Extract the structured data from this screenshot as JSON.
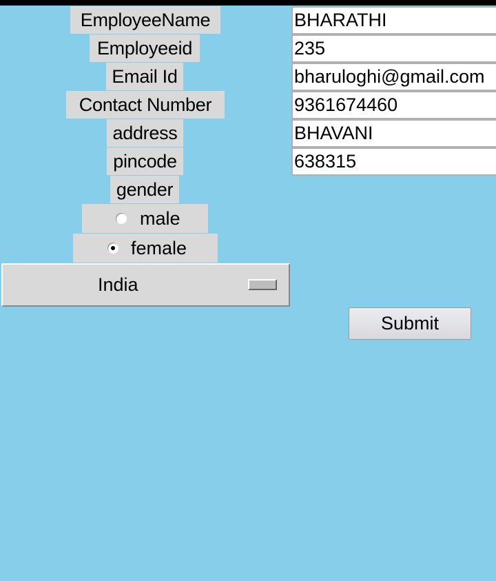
{
  "form": {
    "fields": [
      {
        "label": "EmployeeName",
        "value": "BHARATHI"
      },
      {
        "label": "Employeeid",
        "value": "235"
      },
      {
        "label": "Email Id",
        "value": "bharuloghi@gmail.com"
      },
      {
        "label": "Contact Number",
        "value": "9361674460"
      },
      {
        "label": "address",
        "value": "BHAVANI"
      },
      {
        "label": "pincode",
        "value": "638315"
      }
    ],
    "gender_label": "gender",
    "gender_options": [
      {
        "label": "male",
        "selected": false
      },
      {
        "label": "female",
        "selected": true
      }
    ],
    "country_selected": "India",
    "submit_label": "Submit"
  }
}
